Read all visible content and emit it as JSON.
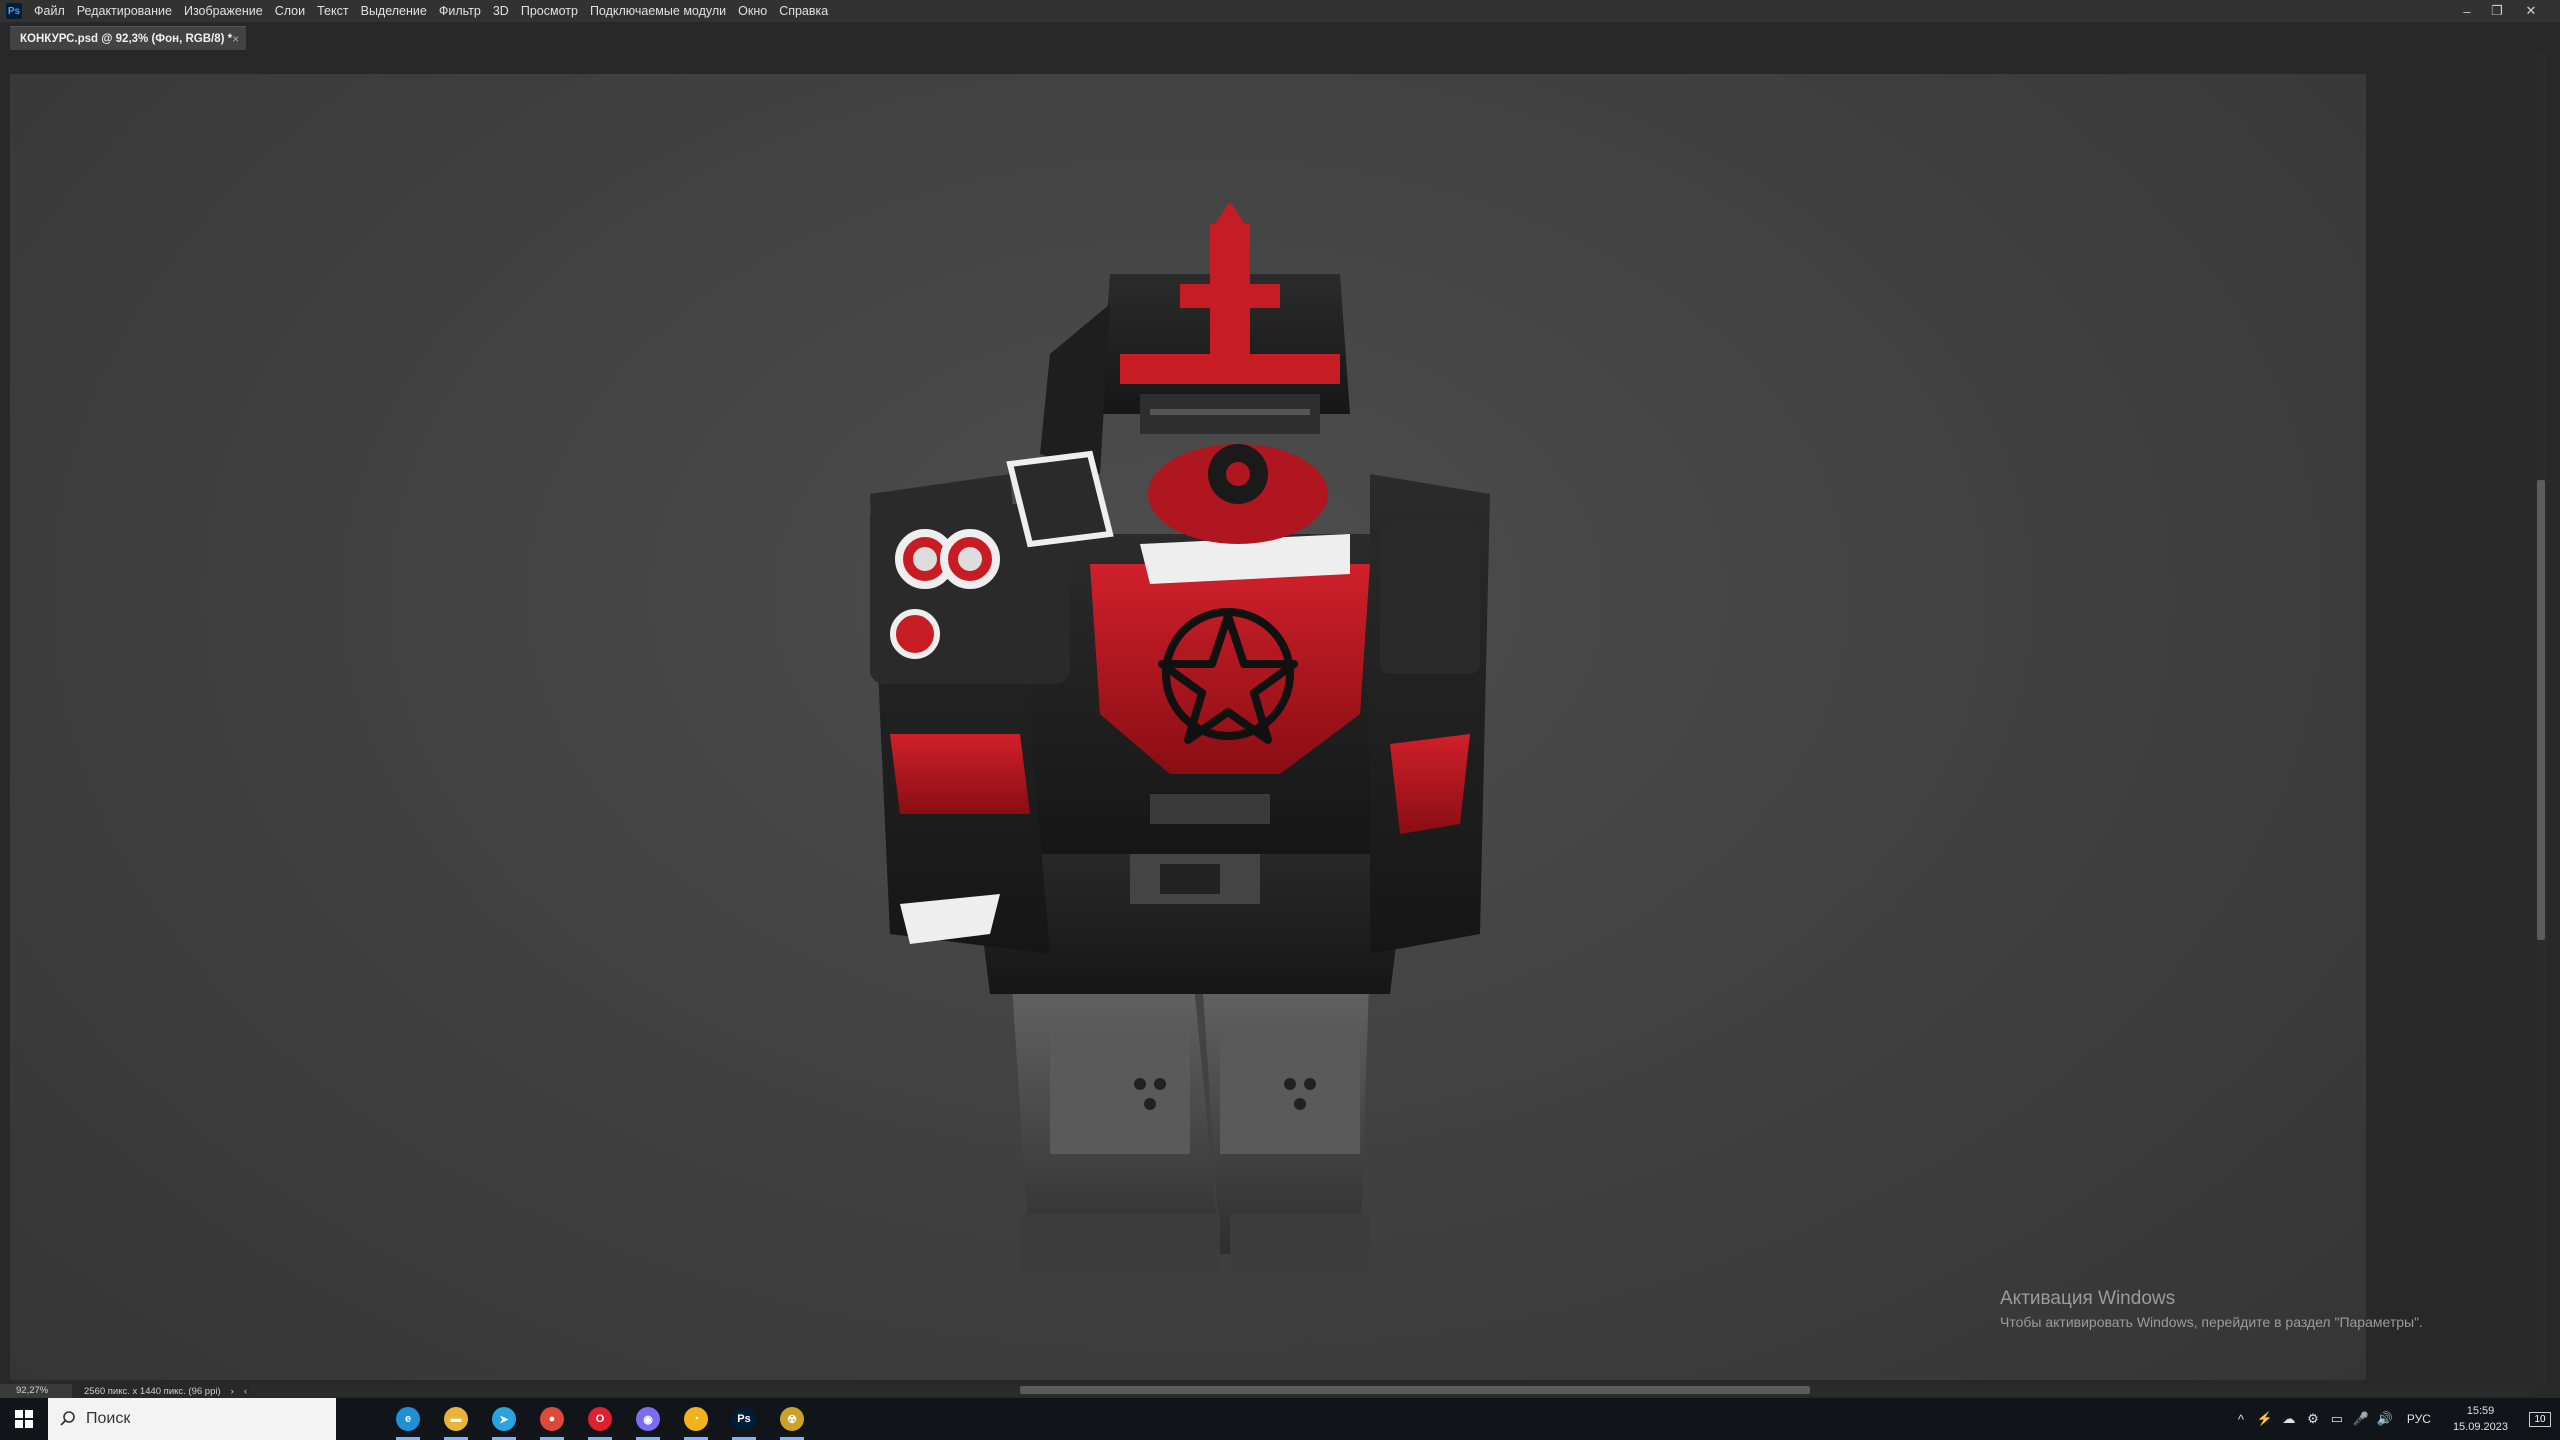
{
  "app": {
    "logo": "Ps",
    "menu": [
      "Файл",
      "Редактирование",
      "Изображение",
      "Слои",
      "Текст",
      "Выделение",
      "Фильтр",
      "3D",
      "Просмотр",
      "Подключаемые модули",
      "Окно",
      "Справка"
    ]
  },
  "window_controls": {
    "minimize": "–",
    "restore": "❐",
    "close": "✕"
  },
  "document_tab": {
    "label": "КОНКУРС.psd @ 92,3% (Фон, RGB/8) *",
    "close": "×"
  },
  "status": {
    "zoom": "92,27%",
    "doc_info": "2560 пикс. x 1440 пикс. (96 ppi)",
    "arrow": "›",
    "back": "‹"
  },
  "activation": {
    "title": "Активация Windows",
    "subtitle": "Чтобы активировать Windows, перейдите в раздел \"Параметры\"."
  },
  "taskbar": {
    "search_placeholder": "Поиск",
    "apps": [
      {
        "name": "edge",
        "glyph": "e",
        "color": "#1f8fd6"
      },
      {
        "name": "explorer",
        "glyph": "▬",
        "color": "#e8b43a"
      },
      {
        "name": "telegram",
        "glyph": "➤",
        "color": "#2aa3de"
      },
      {
        "name": "chrome",
        "glyph": "●",
        "color": "#dd4a3a"
      },
      {
        "name": "opera",
        "glyph": "O",
        "color": "#e0202f"
      },
      {
        "name": "discord",
        "glyph": "◉",
        "color": "#7a6df0"
      },
      {
        "name": "yandex",
        "glyph": "◔",
        "color": "#f3b21b"
      },
      {
        "name": "photoshop",
        "glyph": "Ps",
        "color": "#001e36"
      },
      {
        "name": "game",
        "glyph": "☢",
        "color": "#c9a227"
      }
    ],
    "tray": {
      "icons": [
        "^",
        "⚡",
        "☁",
        "⚙",
        "▭",
        "🎤",
        "🔊"
      ],
      "lang": "РУС",
      "time": "15:59",
      "date": "15.09.2023",
      "notification_count": "10"
    }
  }
}
